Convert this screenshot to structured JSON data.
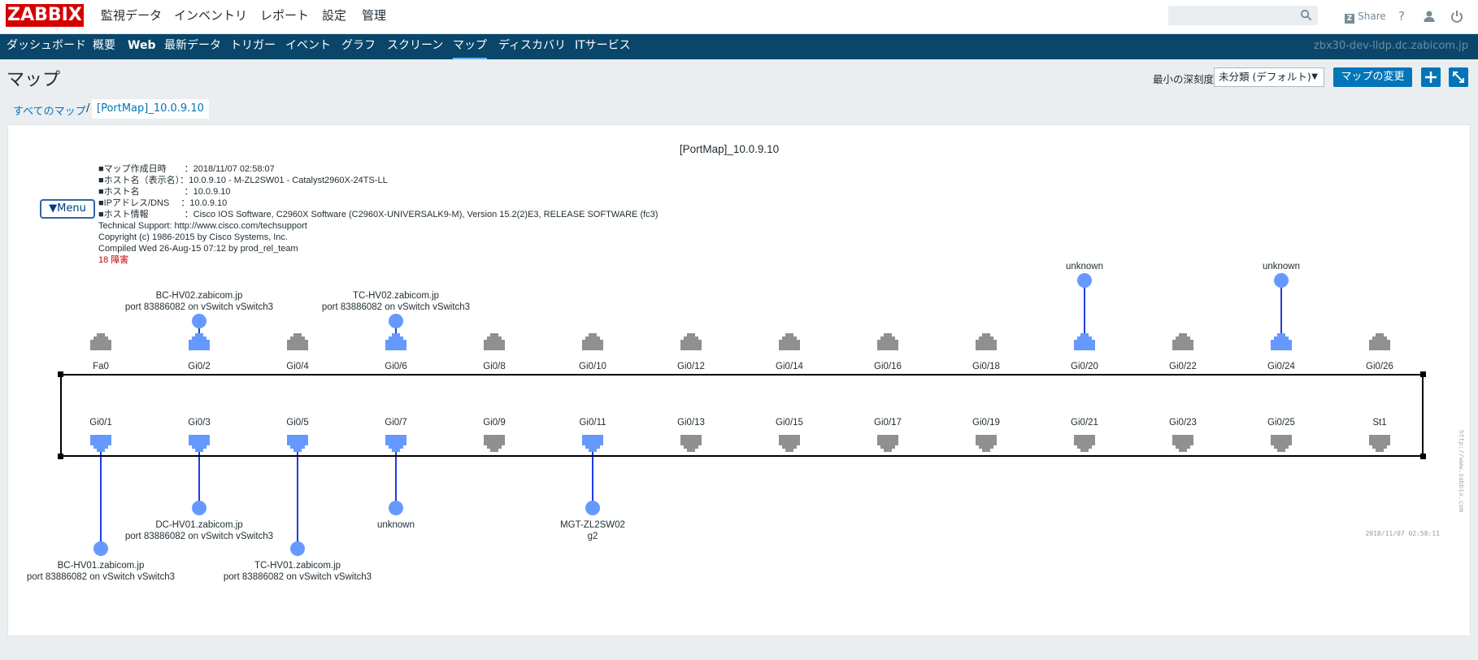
{
  "app": {
    "logo_text": "ZABBIX",
    "server_name": "zbx30-dev-lldp.dc.zabicom.jp"
  },
  "top_menu": {
    "items": [
      "監視データ",
      "インベントリ",
      "レポート",
      "設定",
      "管理"
    ],
    "active_index": 0,
    "share_label": "Share",
    "help_label": "?"
  },
  "nav": {
    "items": [
      "ダッシュボード",
      "概要",
      "Web",
      "最新データ",
      "トリガー",
      "イベント",
      "グラフ",
      "スクリーン",
      "マップ",
      "ディスカバリ",
      "ITサービス"
    ],
    "active_index": 8
  },
  "page": {
    "title": "マップ",
    "severity_label": "最小の深刻度",
    "severity_value": "未分類 (デフォルト)",
    "change_map_label": "マップの変更"
  },
  "breadcrumb": {
    "all_maps": "すべてのマップ",
    "separator": "/",
    "current": "[PortMap]_10.0.9.10"
  },
  "map": {
    "title": "[PortMap]_10.0.9.10",
    "menu_label": "▼Menu",
    "info_lines": [
      "■マップ作成日時　　：2018/11/07 02:58:07",
      "■ホスト名（表示名）：10.0.9.10 - M-ZL2SW01 - Catalyst2960X-24TS-LL",
      "■ホスト名　　　　　：10.0.9.10",
      "■IPアドレス/DNS　  ：10.0.9.10",
      "■ホスト情報　　　　：Cisco IOS Software, C2960X Software (C2960X-UNIVERSALK9-M), Version 15.2(2)E3, RELEASE SOFTWARE (fc3)",
      "Technical Support: http://www.cisco.com/techsupport",
      "Copyright (c) 1986-2015 by Cisco Systems, Inc.",
      "Compiled Wed 26-Aug-15 07:12 by prod_rel_team"
    ],
    "problem_text": "18 障害",
    "side_url": "http://www.zabbix.com",
    "timestamp": "2018/11/07 02:58:11",
    "colors": {
      "port_up": "#6699ff",
      "port_down": "#909090",
      "link": "#1d3ee0",
      "problem": "#cc0000"
    },
    "top_ports": [
      {
        "label": "Fa0",
        "up": false
      },
      {
        "label": "Gi0/2",
        "up": true
      },
      {
        "label": "Gi0/4",
        "up": false
      },
      {
        "label": "Gi0/6",
        "up": true
      },
      {
        "label": "Gi0/8",
        "up": false
      },
      {
        "label": "Gi0/10",
        "up": false
      },
      {
        "label": "Gi0/12",
        "up": false
      },
      {
        "label": "Gi0/14",
        "up": false
      },
      {
        "label": "Gi0/16",
        "up": false
      },
      {
        "label": "Gi0/18",
        "up": false
      },
      {
        "label": "Gi0/20",
        "up": true
      },
      {
        "label": "Gi0/22",
        "up": false
      },
      {
        "label": "Gi0/24",
        "up": true
      },
      {
        "label": "Gi0/26",
        "up": false
      }
    ],
    "bottom_ports": [
      {
        "label": "Gi0/1",
        "up": true
      },
      {
        "label": "Gi0/3",
        "up": true
      },
      {
        "label": "Gi0/5",
        "up": true
      },
      {
        "label": "Gi0/7",
        "up": true
      },
      {
        "label": "Gi0/9",
        "up": false
      },
      {
        "label": "Gi0/11",
        "up": true
      },
      {
        "label": "Gi0/13",
        "up": false
      },
      {
        "label": "Gi0/15",
        "up": false
      },
      {
        "label": "Gi0/17",
        "up": false
      },
      {
        "label": "Gi0/19",
        "up": false
      },
      {
        "label": "Gi0/21",
        "up": false
      },
      {
        "label": "Gi0/23",
        "up": false
      },
      {
        "label": "Gi0/25",
        "up": false
      },
      {
        "label": "St1",
        "up": false
      }
    ],
    "neighbors": [
      {
        "row": "top",
        "col": 1,
        "tier": "far",
        "lines": [
          "BC-HV02.zabicom.jp",
          "port 83886082 on vSwitch vSwitch3"
        ]
      },
      {
        "row": "top",
        "col": 3,
        "tier": "far",
        "lines": [
          "TC-HV02.zabicom.jp",
          "port 83886082 on vSwitch vSwitch3"
        ]
      },
      {
        "row": "top",
        "col": 10,
        "tier": "far2",
        "lines": [
          "unknown"
        ]
      },
      {
        "row": "top",
        "col": 12,
        "tier": "far2",
        "lines": [
          "unknown"
        ]
      },
      {
        "row": "bottom",
        "col": 0,
        "tier": "far",
        "lines": [
          "BC-HV01.zabicom.jp",
          "port 83886082 on vSwitch vSwitch3"
        ]
      },
      {
        "row": "bottom",
        "col": 1,
        "tier": "near",
        "lines": [
          "DC-HV01.zabicom.jp",
          "port 83886082 on vSwitch vSwitch3"
        ]
      },
      {
        "row": "bottom",
        "col": 2,
        "tier": "far",
        "lines": [
          "TC-HV01.zabicom.jp",
          "port 83886082 on vSwitch vSwitch3"
        ]
      },
      {
        "row": "bottom",
        "col": 3,
        "tier": "near",
        "lines": [
          "unknown"
        ]
      },
      {
        "row": "bottom",
        "col": 5,
        "tier": "near",
        "lines": [
          "MGT-ZL2SW02",
          "g2"
        ]
      }
    ]
  }
}
